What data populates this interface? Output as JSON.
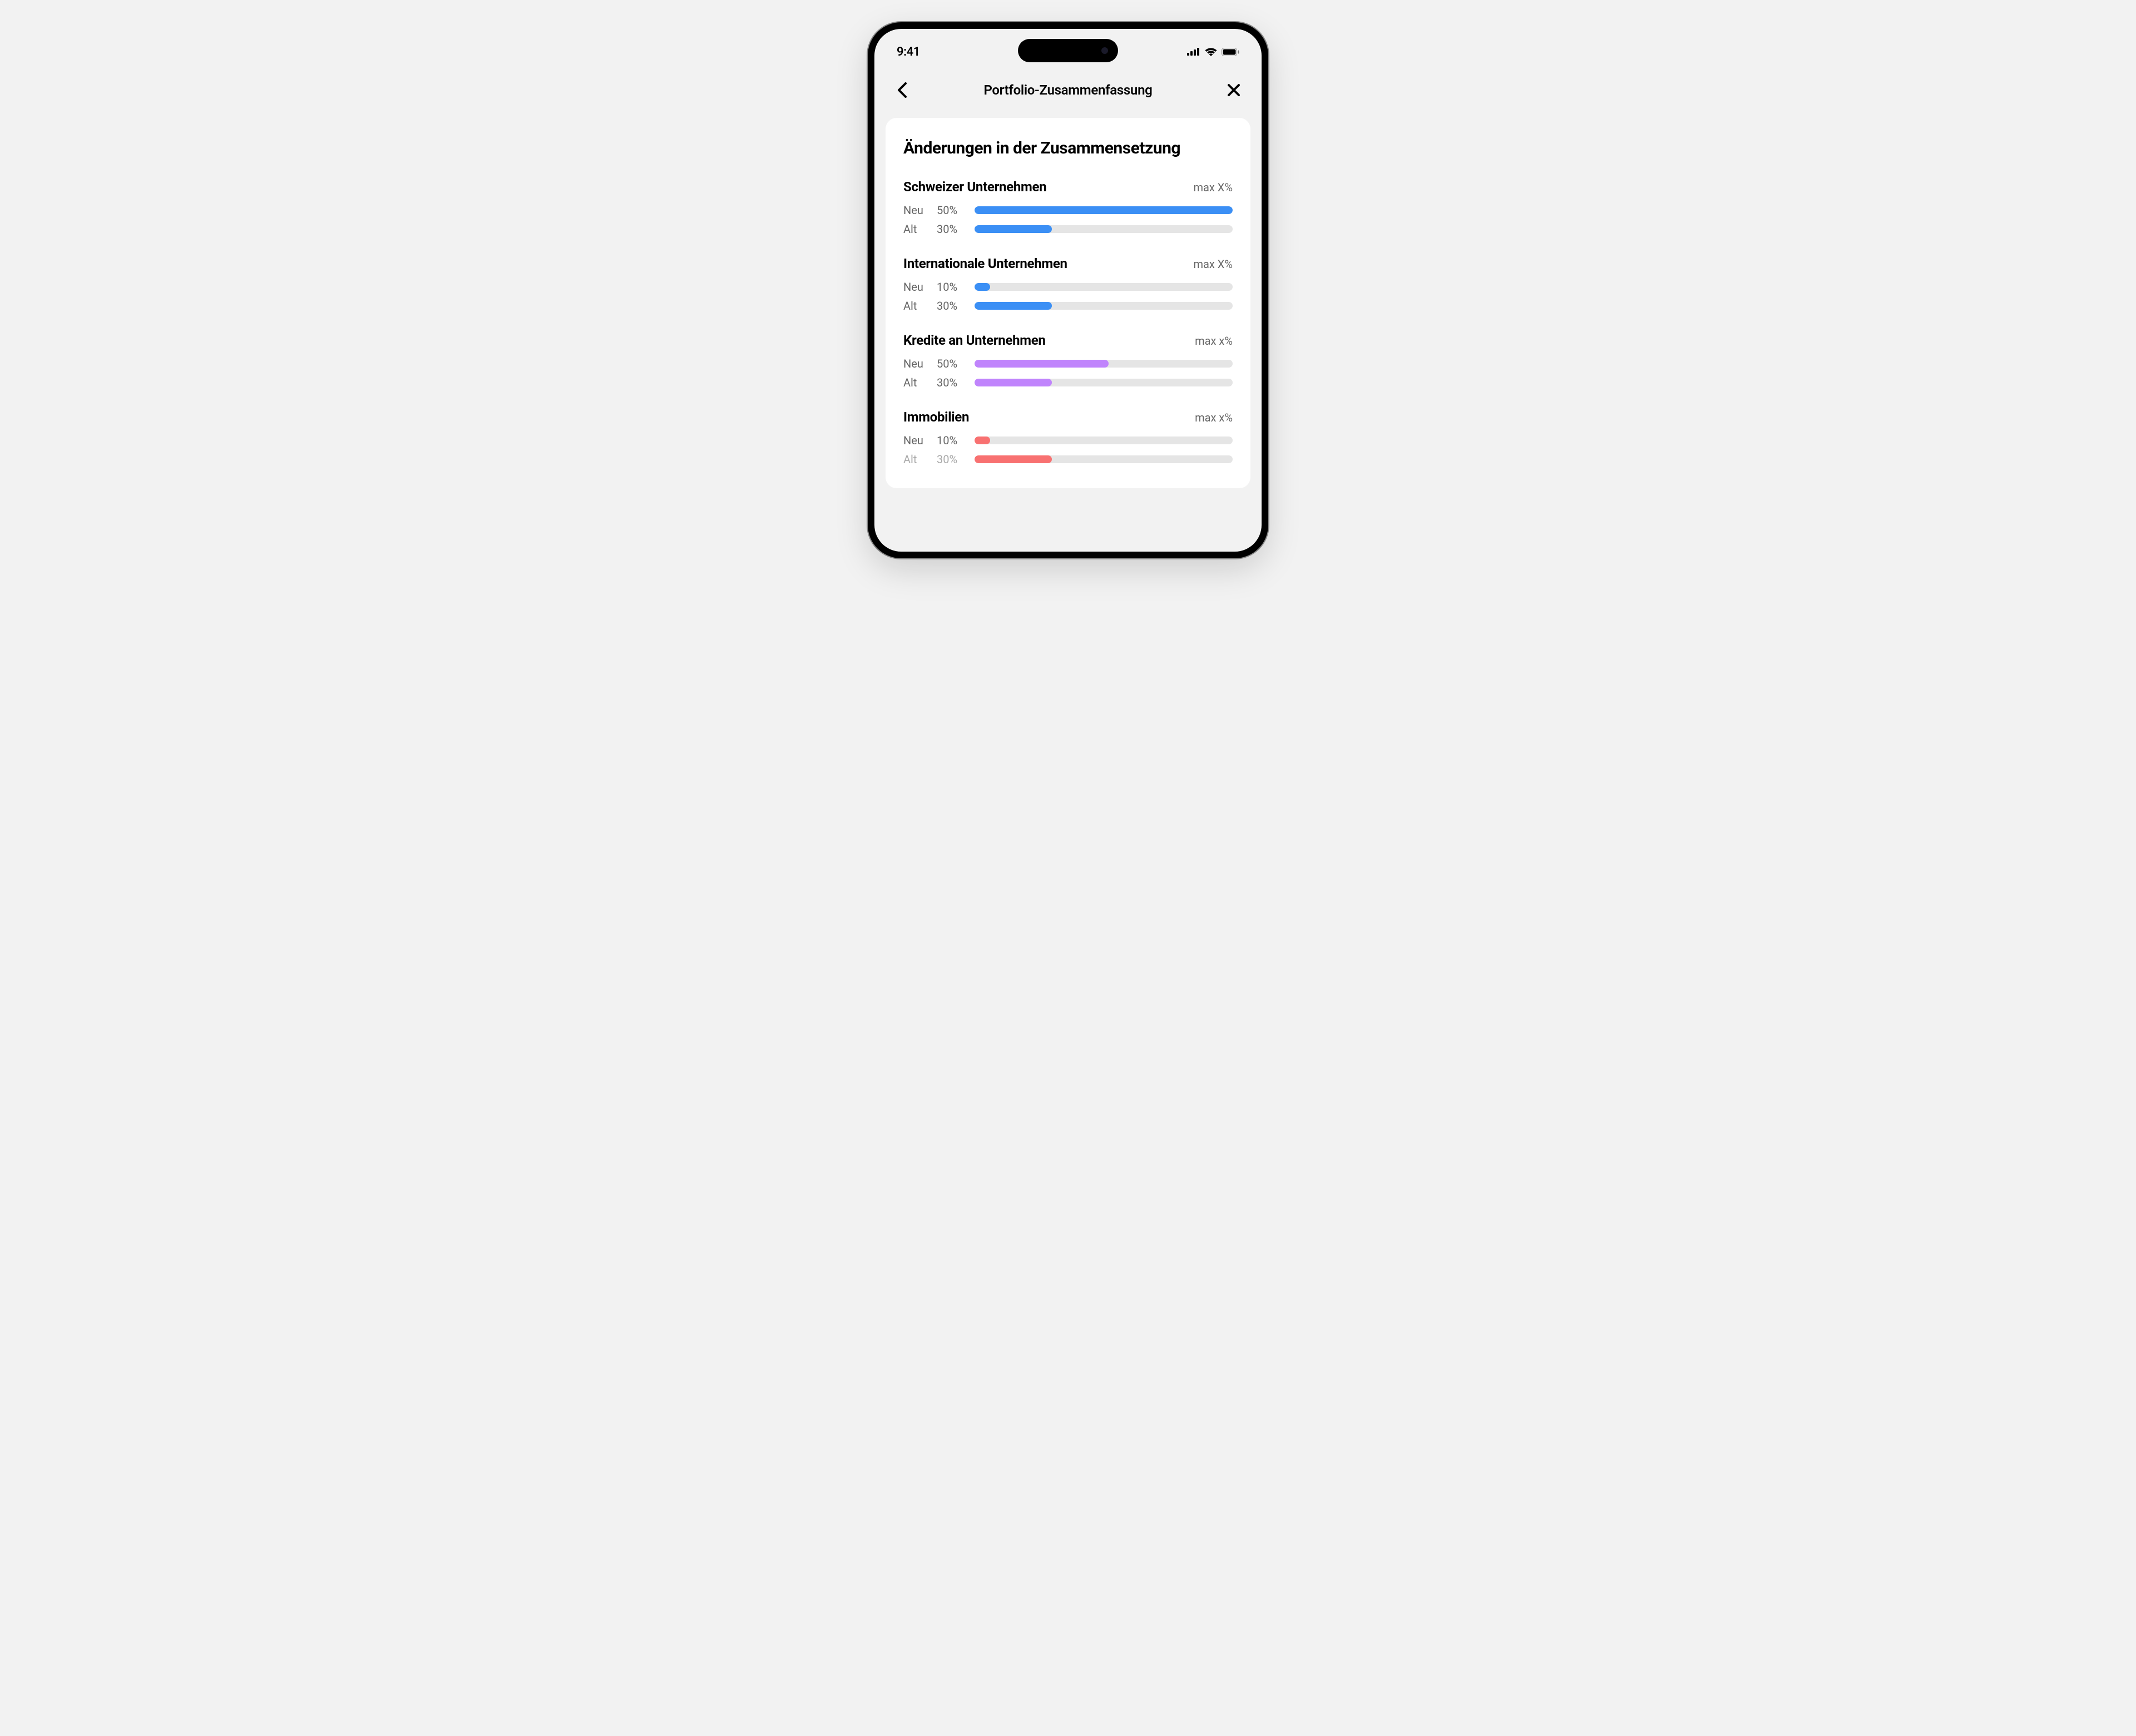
{
  "status": {
    "time": "9:41"
  },
  "nav": {
    "title": "Portfolio-Zusammenfassung"
  },
  "card": {
    "title": "Änderungen in der Zusammensetzung",
    "labels": {
      "new": "Neu",
      "old": "Alt"
    },
    "categories": [
      {
        "name": "Schweizer Unternehmen",
        "max": "max X%",
        "color": "blue",
        "new_pct": 50,
        "old_pct": 30,
        "new_width": 100,
        "old_width": 30
      },
      {
        "name": "Internationale Unternehmen",
        "max": "max X%",
        "color": "blue",
        "new_pct": 10,
        "old_pct": 30,
        "new_width": 6,
        "old_width": 30
      },
      {
        "name": "Kredite an Unternehmen",
        "max": "max x%",
        "color": "purple",
        "new_pct": 50,
        "old_pct": 30,
        "new_width": 52,
        "old_width": 30
      },
      {
        "name": "Immobilien",
        "max": "max x%",
        "color": "red",
        "new_pct": 10,
        "old_pct": 30,
        "new_width": 6,
        "old_width": 30,
        "old_faded": true
      }
    ]
  },
  "chart_data": {
    "type": "bar",
    "title": "Änderungen in der Zusammensetzung",
    "categories": [
      "Schweizer Unternehmen",
      "Internationale Unternehmen",
      "Kredite an Unternehmen",
      "Immobilien"
    ],
    "series": [
      {
        "name": "Neu",
        "values": [
          50,
          10,
          50,
          10
        ]
      },
      {
        "name": "Alt",
        "values": [
          30,
          30,
          30,
          30
        ]
      }
    ],
    "xlabel": "",
    "ylabel": "%",
    "ylim": [
      0,
      100
    ]
  }
}
